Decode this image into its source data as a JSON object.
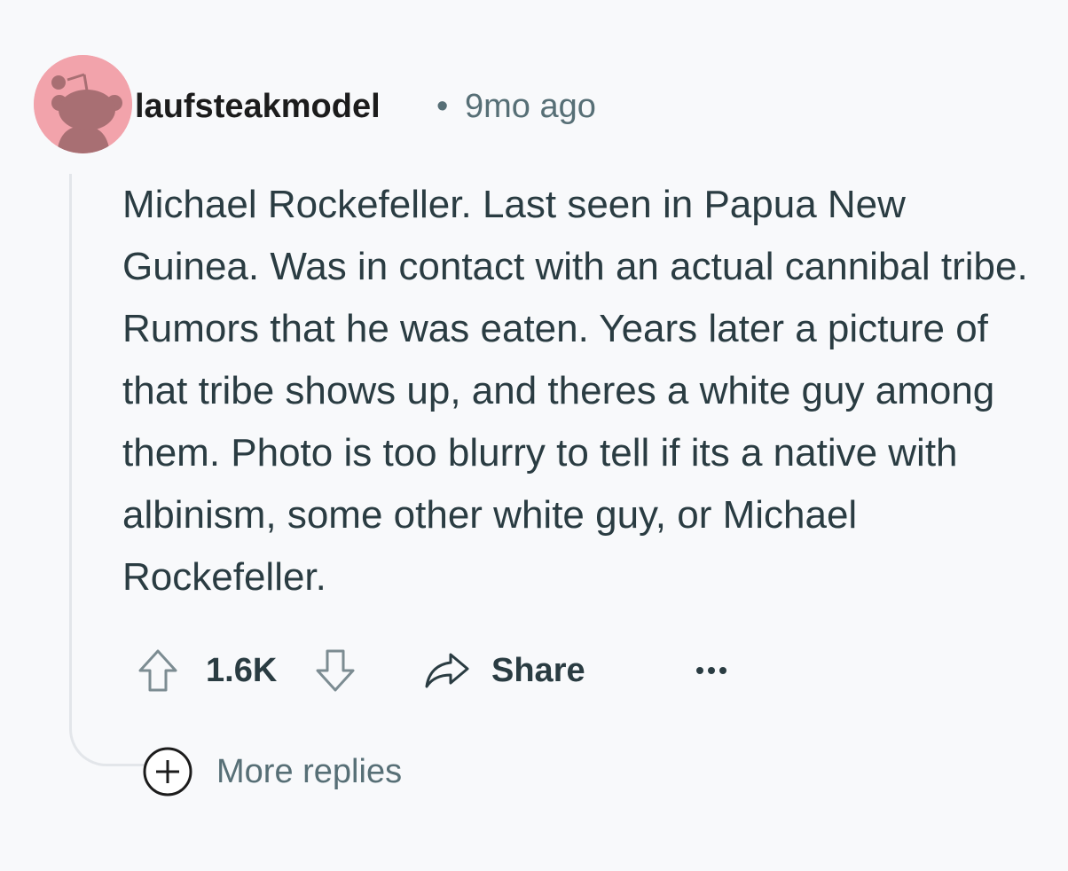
{
  "comment": {
    "author": "laufsteakmodel",
    "separator": "•",
    "timestamp": "9mo ago",
    "avatar_icon": "snoo-avatar-icon",
    "avatar_color": "#f2a3ab",
    "body": "Michael Rockefeller. Last seen in Papua New Guinea. Was in contact with an actual cannibal tribe. Rumors that he was eaten. Years later a picture of that tribe shows up, and theres a white guy among them. Photo is too blurry to tell if its a native with albinism, some other white guy, or Michael Rockefeller."
  },
  "actions": {
    "upvote_icon": "arrow-up-icon",
    "score": "1.6K",
    "downvote_icon": "arrow-down-icon",
    "share_icon": "share-arrow-icon",
    "share_label": "Share",
    "more_icon": "ellipsis-icon"
  },
  "replies": {
    "expand_icon": "plus-circle-icon",
    "more_label": "More replies"
  }
}
